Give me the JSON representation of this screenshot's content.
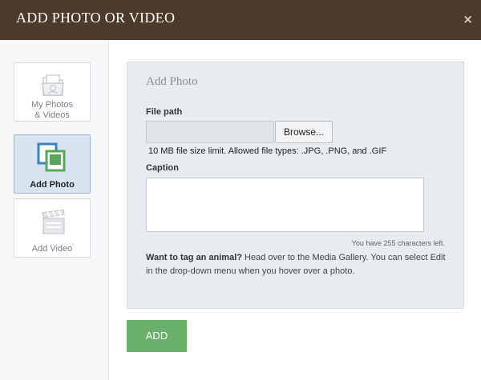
{
  "dialog": {
    "title": "ADD PHOTO OR VIDEO",
    "close_glyph": "×"
  },
  "sidebar": {
    "items": [
      {
        "line1": "My Photos",
        "line2": "& Videos",
        "icon": "folder-photo-icon",
        "active": false
      },
      {
        "label": "Add Photo",
        "icon": "add-photo-icon",
        "active": true
      },
      {
        "label": "Add Video",
        "icon": "clapperboard-icon",
        "active": false
      }
    ]
  },
  "form": {
    "heading": "Add Photo",
    "file_path_label": "File path",
    "file_path_value": "",
    "browse_label": "Browse...",
    "file_hint": "10 MB file size limit. Allowed file types: .JPG, .PNG, and .GIF",
    "caption_label": "Caption",
    "caption_value": "",
    "char_count": "You have 255 characters left.",
    "tag_bold": "Want to tag an animal?",
    "tag_rest": " Head over to the Media Gallery. You can select Edit in the drop-down menu when you hover over a photo."
  },
  "actions": {
    "add_label": "ADD"
  },
  "colors": {
    "titlebar": "#4c3a2a",
    "add_button": "#6ab06a",
    "active_nav": "#d9e4f1",
    "icon_blue": "#3b7fc4",
    "icon_green": "#5aa55a"
  }
}
